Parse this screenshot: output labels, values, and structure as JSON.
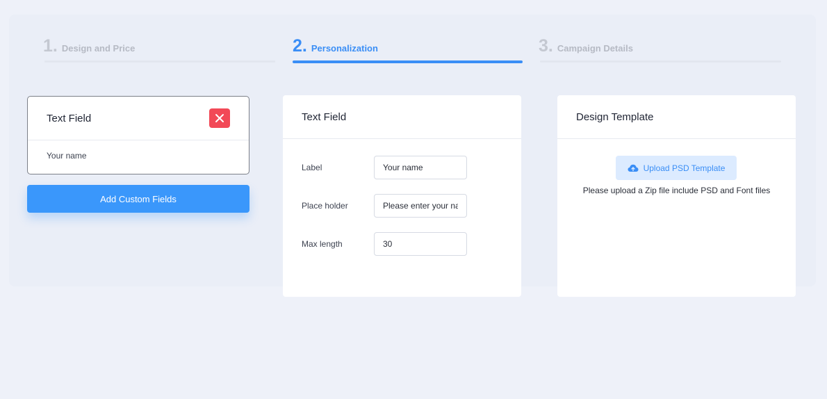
{
  "steps": [
    {
      "number": "1.",
      "label": "Design and Price",
      "active": false
    },
    {
      "number": "2.",
      "label": "Personalization",
      "active": true
    },
    {
      "number": "3.",
      "label": "Campaign Details",
      "active": false
    }
  ],
  "field_preview": {
    "title": "Text Field",
    "value": "Your name",
    "delete_icon": "close-icon"
  },
  "add_button": {
    "label": "Add Custom Fields"
  },
  "settings": {
    "title": "Text Field",
    "label_caption": "Label",
    "label_value": "Your name",
    "placeholder_caption": "Place holder",
    "placeholder_value": "Please enter your name",
    "maxlength_caption": "Max length",
    "maxlength_value": "30"
  },
  "template": {
    "title": "Design Template",
    "upload_label": "Upload PSD Template",
    "upload_icon": "cloud-upload-icon",
    "note": "Please upload a Zip file include PSD and Font files"
  },
  "colors": {
    "accent": "#3a8ef6",
    "danger": "#f24957",
    "background": "#eef1f9"
  }
}
